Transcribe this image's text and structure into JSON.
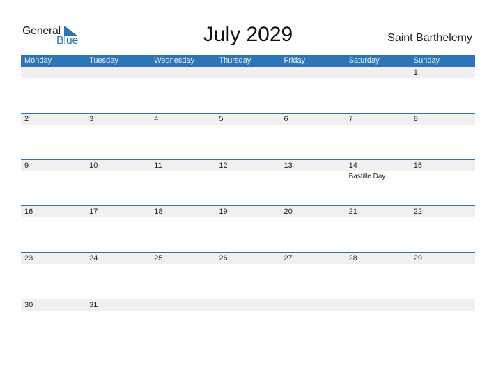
{
  "logo": {
    "line1": "General",
    "line2": "Blue",
    "brand_color": "#2e75b6"
  },
  "title": "July 2029",
  "country": "Saint Barthelemy",
  "weekdays": [
    "Monday",
    "Tuesday",
    "Wednesday",
    "Thursday",
    "Friday",
    "Saturday",
    "Sunday"
  ],
  "weeks": [
    [
      {
        "day": ""
      },
      {
        "day": ""
      },
      {
        "day": ""
      },
      {
        "day": ""
      },
      {
        "day": ""
      },
      {
        "day": ""
      },
      {
        "day": "1"
      }
    ],
    [
      {
        "day": "2"
      },
      {
        "day": "3"
      },
      {
        "day": "4"
      },
      {
        "day": "5"
      },
      {
        "day": "6"
      },
      {
        "day": "7"
      },
      {
        "day": "8"
      }
    ],
    [
      {
        "day": "9"
      },
      {
        "day": "10"
      },
      {
        "day": "11"
      },
      {
        "day": "12"
      },
      {
        "day": "13"
      },
      {
        "day": "14",
        "event": "Bastille Day"
      },
      {
        "day": "15"
      }
    ],
    [
      {
        "day": "16"
      },
      {
        "day": "17"
      },
      {
        "day": "18"
      },
      {
        "day": "19"
      },
      {
        "day": "20"
      },
      {
        "day": "21"
      },
      {
        "day": "22"
      }
    ],
    [
      {
        "day": "23"
      },
      {
        "day": "24"
      },
      {
        "day": "25"
      },
      {
        "day": "26"
      },
      {
        "day": "27"
      },
      {
        "day": "28"
      },
      {
        "day": "29"
      }
    ],
    [
      {
        "day": "30"
      },
      {
        "day": "31"
      },
      {
        "day": ""
      },
      {
        "day": ""
      },
      {
        "day": ""
      },
      {
        "day": ""
      },
      {
        "day": ""
      }
    ]
  ],
  "colors": {
    "header_bg": "#2e75b6",
    "row_band": "#f0f0f0"
  }
}
